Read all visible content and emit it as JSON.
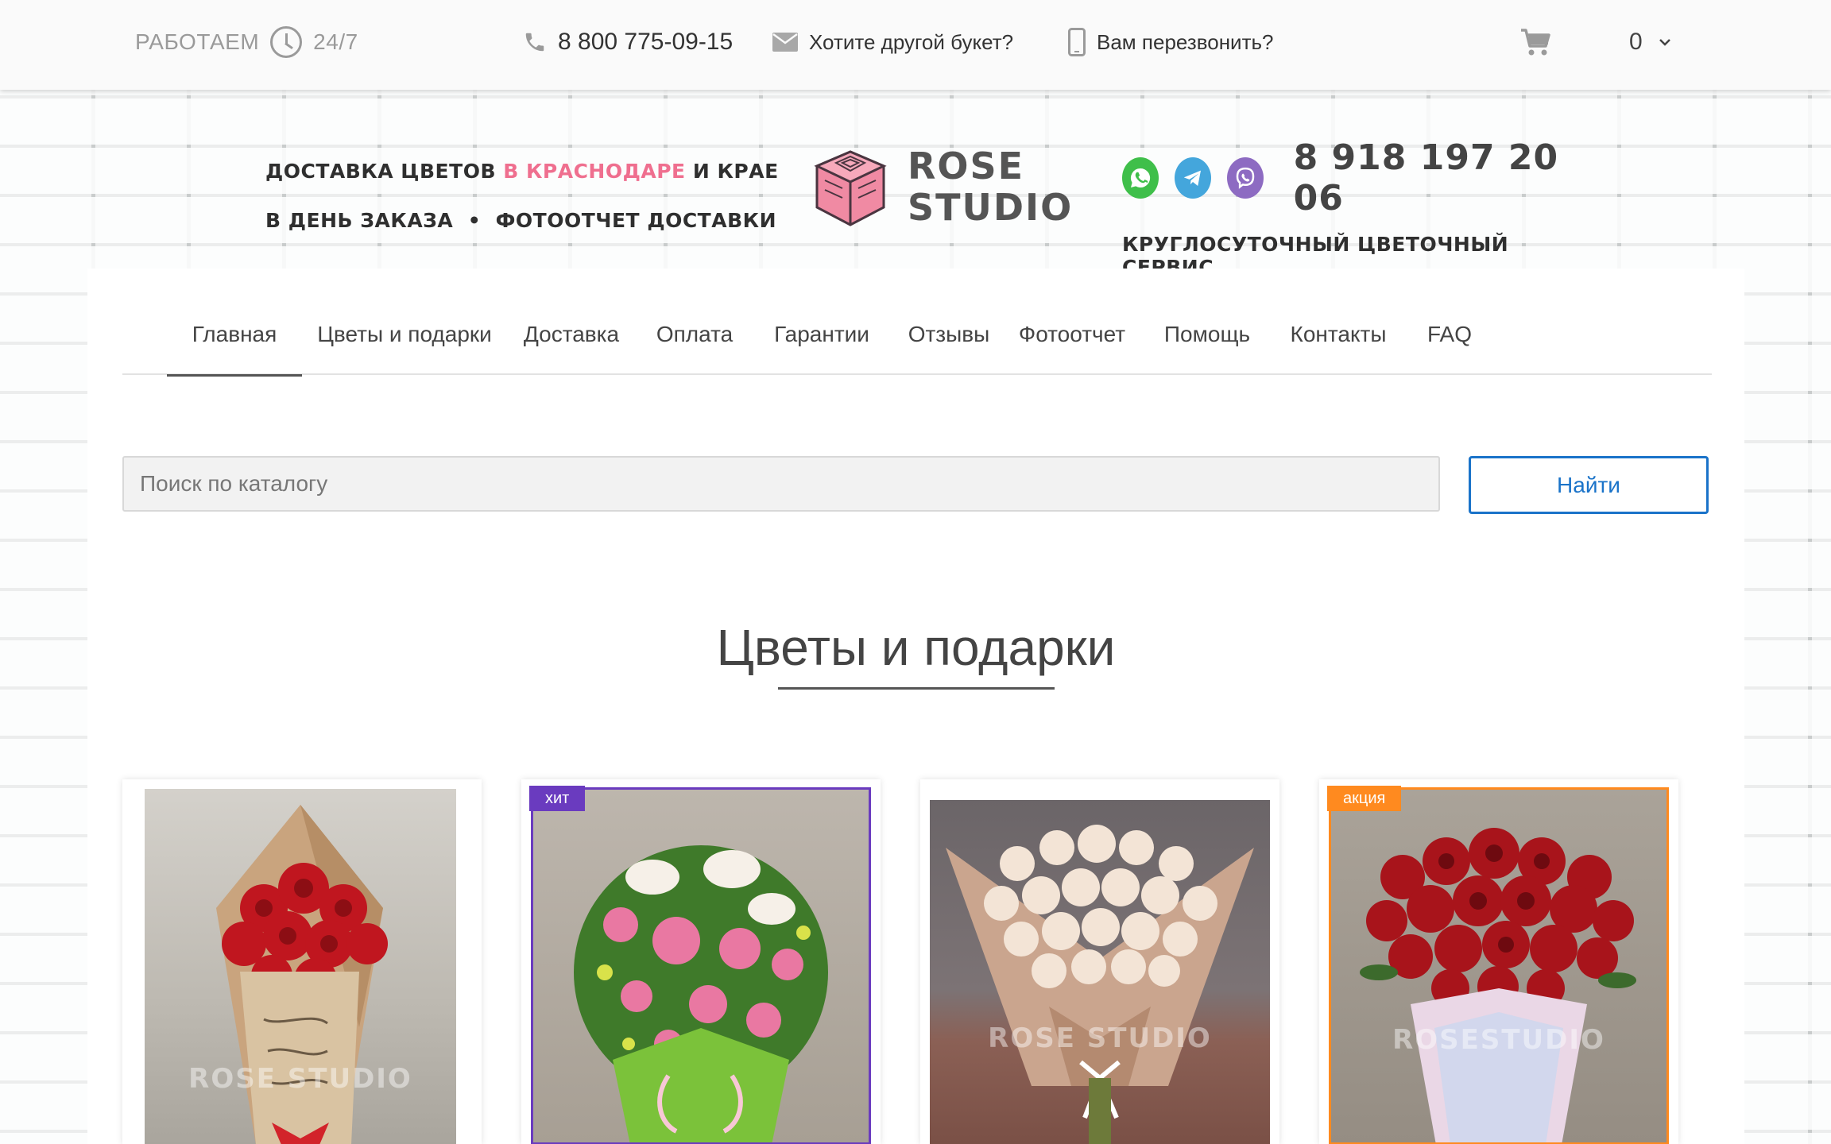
{
  "topbar": {
    "work_label": "РАБОТАЕМ",
    "work_hours": "24/7",
    "phone": "8 800 775-09-15",
    "other_bouquet": "Хотите другой букет?",
    "callback": "Вам перезвонить?",
    "cart_count": "0"
  },
  "header": {
    "line1_a": "ДОСТАВКА ЦВЕТОВ",
    "line1_accent": "В КРАСНОДАРЕ",
    "line1_b": "И КРАЕ",
    "line2_a": "В ДЕНЬ ЗАКАЗА",
    "line2_sep": "•",
    "line2_b": "ФОТООТЧЕТ ДОСТАВКИ",
    "logo_line1": "ROSE",
    "logo_line2": "STUDIO",
    "phone": "8 918 197 20 06",
    "service": "КРУГЛОСУТОЧНЫЙ ЦВЕТОЧНЫЙ СЕРВИС"
  },
  "nav": {
    "items": [
      {
        "label": "Главная"
      },
      {
        "label": "Цветы и подарки"
      },
      {
        "label": "Доставка"
      },
      {
        "label": "Оплата"
      },
      {
        "label": "Гарантии"
      },
      {
        "label": "Отзывы"
      },
      {
        "label": "Фотоотчет"
      },
      {
        "label": "Помощь"
      },
      {
        "label": "Контакты"
      },
      {
        "label": "FAQ"
      }
    ]
  },
  "search": {
    "placeholder": "Поиск по каталогу",
    "button": "Найти"
  },
  "section": {
    "title": "Цветы и подарки"
  },
  "products": [
    {
      "badge": "",
      "watermark": "ROSE STUDIO"
    },
    {
      "badge": "хит",
      "watermark": ""
    },
    {
      "badge": "",
      "watermark": "ROSE STUDIO"
    },
    {
      "badge": "акция",
      "watermark": "ROSESTUDIO"
    }
  ],
  "colors": {
    "accent_pink": "#ef6f8f",
    "button_blue": "#1a73c9",
    "badge_hit": "#6a3bbf",
    "badge_sale": "#ff8a1f",
    "whatsapp": "#3fbf4a",
    "telegram": "#44a6dc",
    "viber": "#8d6bc2"
  }
}
